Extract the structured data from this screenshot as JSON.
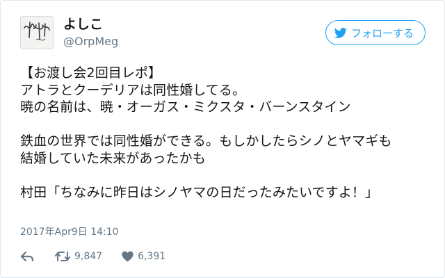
{
  "user": {
    "display_name": "よしこ",
    "screen_name": "@OrpMeg",
    "avatar_icon": "signature-avatar-icon"
  },
  "follow_button": {
    "label": "フォローする",
    "icon": "twitter-bird-icon"
  },
  "tweet": {
    "lines": [
      "【お渡し会2回目レポ】",
      "アトラとクーデリアは同性婚してる。",
      "暁の名前は、暁・オーガス・ミクスタ・バーンスタイン",
      "",
      "鉄血の世界では同性婚ができる。もしかしたらシノとヤマギも",
      "結婚していた未来があったかも",
      "",
      "村田「ちなみに昨日はシノヤマの日だったみたいですよ！」"
    ]
  },
  "timestamp": "2017年Apr9日 14:10",
  "actions": {
    "reply_icon": "reply-icon",
    "retweet_icon": "retweet-icon",
    "retweet_count": "9,847",
    "like_icon": "heart-icon",
    "like_count": "6,391"
  },
  "colors": {
    "accent": "#1da1f2",
    "text": "#14171a",
    "secondary": "#657786",
    "border": "#e1e8ed"
  }
}
